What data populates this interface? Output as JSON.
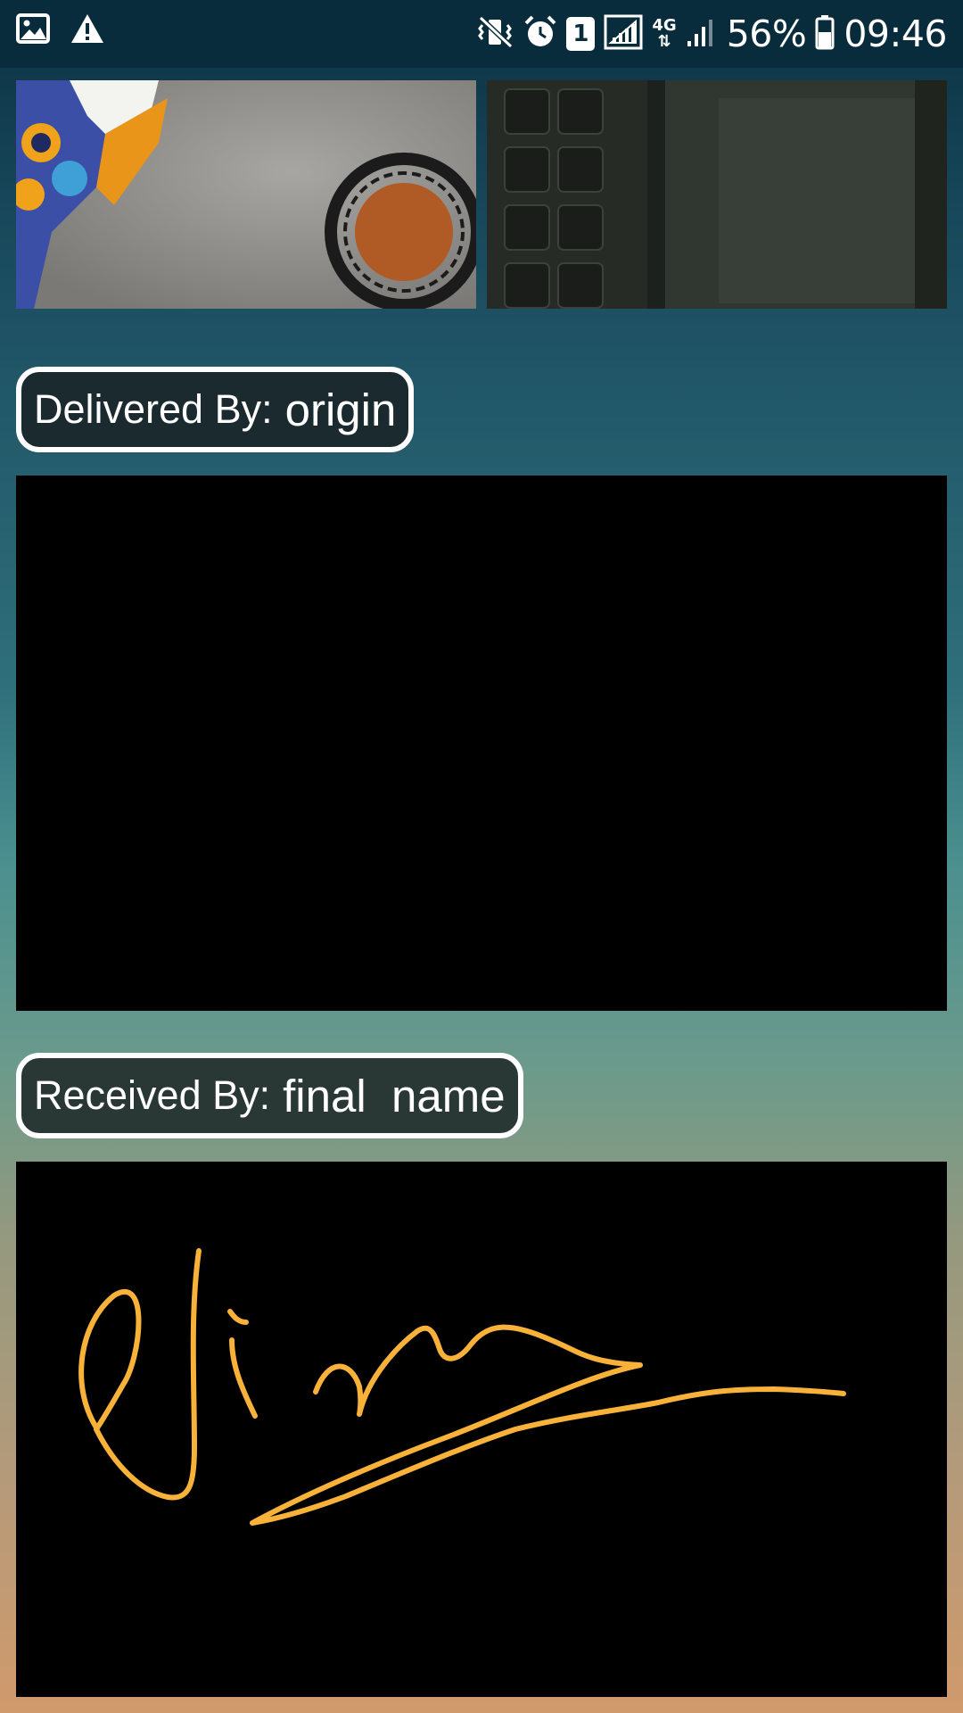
{
  "status_bar": {
    "left_icons": [
      "image-icon",
      "warning-icon"
    ],
    "right_icons": [
      "mute-vibrate-icon",
      "alarm-icon",
      "sim-1-icon",
      "wifi-calling-signal-icon",
      "4g-data-icon",
      "signal-strength-icon",
      "battery-icon"
    ],
    "sim_slot": "1",
    "network_type": "4G",
    "battery_percent": "56%",
    "time": "09:46"
  },
  "photos": [
    {
      "description_icon": "photo-thumbnail-1"
    },
    {
      "description_icon": "photo-thumbnail-2"
    }
  ],
  "delivered": {
    "prefix": "Delivered By:",
    "name": "origin"
  },
  "received": {
    "prefix": "Received By:",
    "name": "final  name"
  },
  "colors": {
    "signature_stroke": "#f8b23a",
    "panel_background": "#000000",
    "label_border": "#ffffff"
  }
}
